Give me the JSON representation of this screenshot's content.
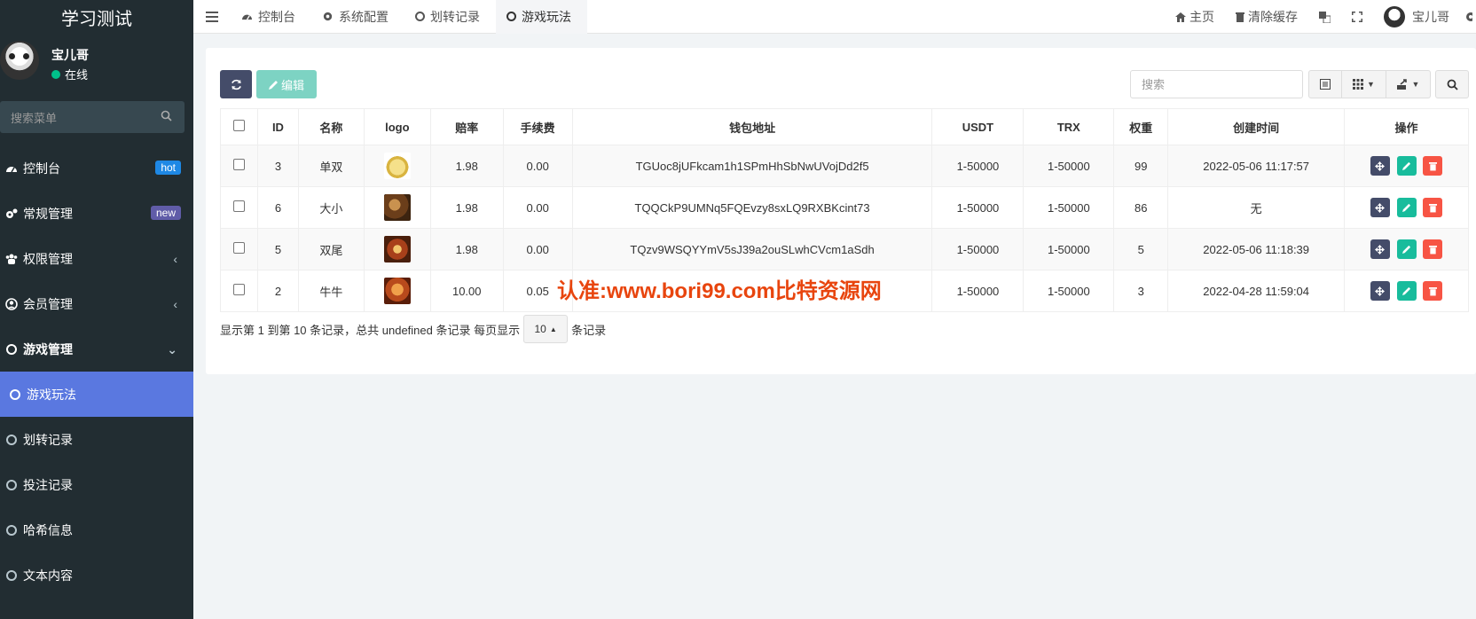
{
  "brand": {
    "title": "学习测试"
  },
  "user": {
    "name": "宝儿哥",
    "status": "在线"
  },
  "sidebar": {
    "search_placeholder": "搜索菜单",
    "items": [
      {
        "label": "控制台",
        "icon": "dashboard-icon",
        "badge": "hot"
      },
      {
        "label": "常规管理",
        "icon": "cogs-icon",
        "badge": "new"
      },
      {
        "label": "权限管理",
        "icon": "group-icon",
        "chevron": "‹"
      },
      {
        "label": "会员管理",
        "icon": "user-circle-icon",
        "chevron": "‹"
      },
      {
        "label": "游戏管理",
        "icon": "circle-icon",
        "chevron": "⌄"
      },
      {
        "label": "游戏玩法",
        "icon": "circle-icon",
        "active": true
      },
      {
        "label": "划转记录",
        "icon": "circle-icon"
      },
      {
        "label": "投注记录",
        "icon": "circle-icon"
      },
      {
        "label": "哈希信息",
        "icon": "circle-icon"
      },
      {
        "label": "文本内容",
        "icon": "circle-icon"
      }
    ]
  },
  "topnav": {
    "tabs": [
      {
        "label": "控制台",
        "icon": "dashboard-icon"
      },
      {
        "label": "系统配置",
        "icon": "gear-icon"
      },
      {
        "label": "划转记录",
        "icon": "circle-icon"
      },
      {
        "label": "游戏玩法",
        "icon": "circle-icon",
        "active": true
      }
    ],
    "home": "主页",
    "clear_cache": "清除缓存",
    "username": "宝儿哥"
  },
  "toolbar": {
    "edit_label": "编辑",
    "search_placeholder": "搜索"
  },
  "table": {
    "headers": [
      "ID",
      "名称",
      "logo",
      "赔率",
      "手续费",
      "钱包地址",
      "USDT",
      "TRX",
      "权重",
      "创建时间",
      "操作"
    ],
    "rows": [
      {
        "id": "3",
        "name": "单双",
        "logo": "#e8d27a",
        "odds": "1.98",
        "fee": "0.00",
        "wallet": "TGUoc8jUFkcam1h1SPmHhSbNwUVojDd2f5",
        "usdt": "1-50000",
        "trx": "1-50000",
        "weight": "99",
        "created": "2022-05-06 11:17:57"
      },
      {
        "id": "6",
        "name": "大小",
        "logo": "#8a5a2b",
        "odds": "1.98",
        "fee": "0.00",
        "wallet": "TQQCkP9UMNq5FQEvzy8sxLQ9RXBKcint73",
        "usdt": "1-50000",
        "trx": "1-50000",
        "weight": "86",
        "created": "无"
      },
      {
        "id": "5",
        "name": "双尾",
        "logo": "#b5541e",
        "odds": "1.98",
        "fee": "0.00",
        "wallet": "TQzv9WSQYYmV5sJ39a2ouSLwhCVcm1aSdh",
        "usdt": "1-50000",
        "trx": "1-50000",
        "weight": "5",
        "created": "2022-05-06 11:18:39"
      },
      {
        "id": "2",
        "name": "牛牛",
        "logo": "#c0562a",
        "odds": "10.00",
        "fee": "0.05",
        "wallet": "",
        "usdt": "1-50000",
        "trx": "1-50000",
        "weight": "3",
        "created": "2022-04-28 11:59:04"
      }
    ]
  },
  "pager": {
    "summary": "显示第 1 到第 10 条记录，总共 undefined 条记录 每页显示",
    "page_size": "10",
    "suffix": "条记录"
  },
  "watermark": "认准:www.bori99.com比特资源网",
  "colors": {
    "sidebar": "#222d32",
    "active": "#5a78e0",
    "primary": "#444c69",
    "success": "#18bc9c",
    "danger": "#f75444",
    "watermark": "#e8450e"
  }
}
